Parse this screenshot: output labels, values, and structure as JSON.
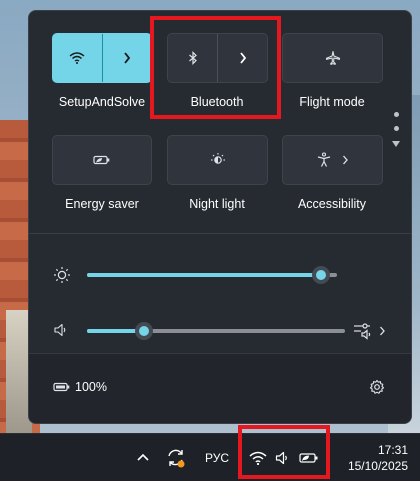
{
  "quick_settings": {
    "wifi": {
      "label": "SetupAndSolve",
      "active": true
    },
    "bluetooth": {
      "label": "Bluetooth",
      "active": false
    },
    "flight_mode": {
      "label": "Flight mode"
    },
    "energy_saver": {
      "label": "Energy saver"
    },
    "night_light": {
      "label": "Night light"
    },
    "accessibility": {
      "label": "Accessibility"
    },
    "brightness_level": 0.97,
    "volume_level": 0.2,
    "battery_text": "100%"
  },
  "taskbar": {
    "language": "РУС",
    "time": "17:31",
    "date": "15/10/2025"
  },
  "colors": {
    "accent": "#74d4e8",
    "panel_bg": "#262a31",
    "highlight": "#e5181f"
  }
}
